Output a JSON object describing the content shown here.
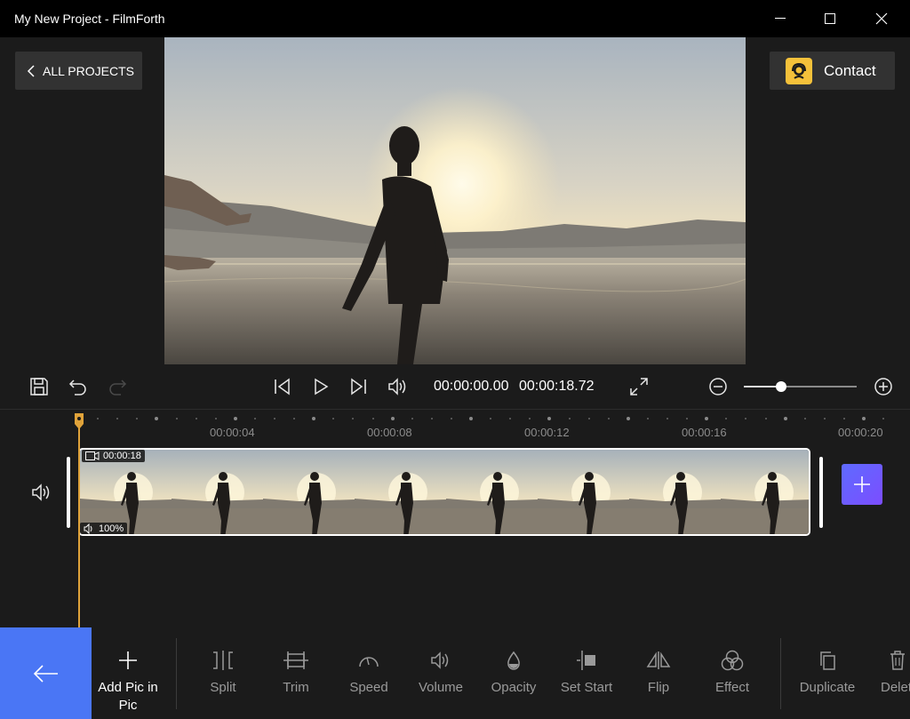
{
  "window": {
    "title": "My New Project - FilmForth"
  },
  "header": {
    "back_label": "ALL PROJECTS",
    "contact_label": "Contact"
  },
  "playback": {
    "current_time": "00:00:00.00",
    "total_time": "00:00:18.72",
    "zoom_level": 0.33
  },
  "ruler": {
    "labels": [
      "00:00:04",
      "00:00:08",
      "00:00:12",
      "00:00:16",
      "00:00:20"
    ]
  },
  "clip": {
    "duration": "00:00:18",
    "volume": "100%"
  },
  "toolbar": {
    "add_pip_label": "Add Pic in Pic",
    "split_label": "Split",
    "trim_label": "Trim",
    "speed_label": "Speed",
    "volume_label": "Volume",
    "opacity_label": "Opacity",
    "set_start_label": "Set Start",
    "flip_label": "Flip",
    "effect_label": "Effect",
    "duplicate_label": "Duplicate",
    "delete_label": "Delete"
  },
  "colors": {
    "accent_blue": "#4a76f5",
    "playhead": "#e0a33a",
    "contact_icon": "#f5c13a"
  }
}
